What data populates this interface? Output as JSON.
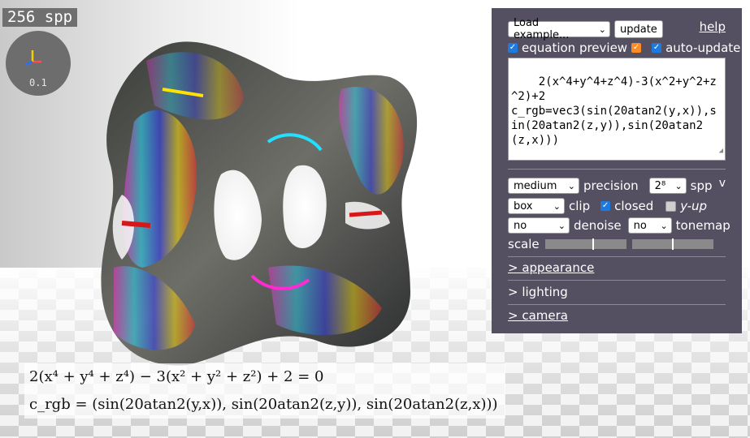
{
  "viewport": {
    "spp_label": "256 spp",
    "gizmo_scale": "0.1",
    "formula_line1": "2(x⁴ + y⁴ + z⁴) − 3(x² + y² + z²) + 2 = 0",
    "formula_line2": "c_rgb = (sin(20atan2(y,x)), sin(20atan2(z,y)), sin(20atan2(z,x)))",
    "axis_colors": {
      "x": "#ff4d4d",
      "y": "#f0d000",
      "z": "#2f6bff"
    }
  },
  "panel": {
    "load_example": "Load example...",
    "update_button": "update",
    "help_link": "help",
    "equation_preview_label": "equation preview",
    "equation_preview_checked": true,
    "equation_preview_color_checked": true,
    "auto_update_label": "auto-update",
    "auto_update_checked": true,
    "equation_text": "2(x^4+y^4+z^4)-3(x^2+y^2+z^2)+2\nc_rgb=vec3(sin(20atan2(y,x)),sin(20atan2(z,y)),sin(20atan2(z,x)))",
    "precision_value": "medium",
    "precision_label": "precision",
    "spp_value": "2⁸",
    "spp_label": "spp",
    "collapse_glyph": "v",
    "clip_value": "box",
    "clip_label": "clip",
    "closed_label": "closed",
    "closed_checked": true,
    "yup_label": "y-up",
    "yup_checked": false,
    "denoise_value": "no",
    "denoise_label": "denoise",
    "tonemap_value": "no",
    "tonemap_label": "tonemap",
    "scale_label": "scale",
    "scale_slider1": 0.6,
    "scale_slider2": 0.5,
    "appearance_link": "> appearance",
    "lighting_link": "> lighting",
    "camera_link": "> camera"
  }
}
